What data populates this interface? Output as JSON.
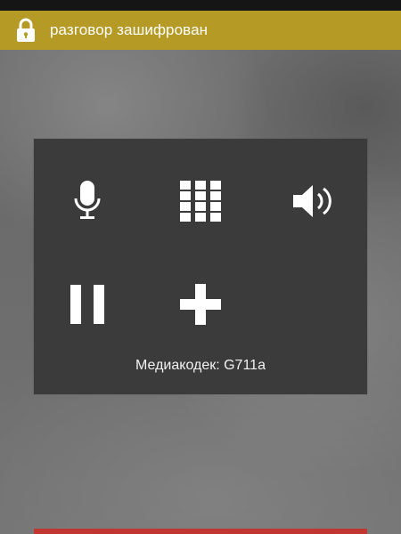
{
  "banner": {
    "icon": "lock-icon",
    "text": "разговор зашифрован",
    "color": "#b59a25"
  },
  "panel": {
    "controls": [
      {
        "name": "mute",
        "icon": "microphone-icon"
      },
      {
        "name": "keypad",
        "icon": "dialpad-icon"
      },
      {
        "name": "speaker",
        "icon": "speaker-icon"
      },
      {
        "name": "hold",
        "icon": "pause-icon"
      },
      {
        "name": "add-call",
        "icon": "plus-icon"
      }
    ],
    "codec_text": "Медиакодек: G711a"
  },
  "colors": {
    "panel_bg": "#3b3b3b",
    "end_call_bar": "#c23632"
  }
}
